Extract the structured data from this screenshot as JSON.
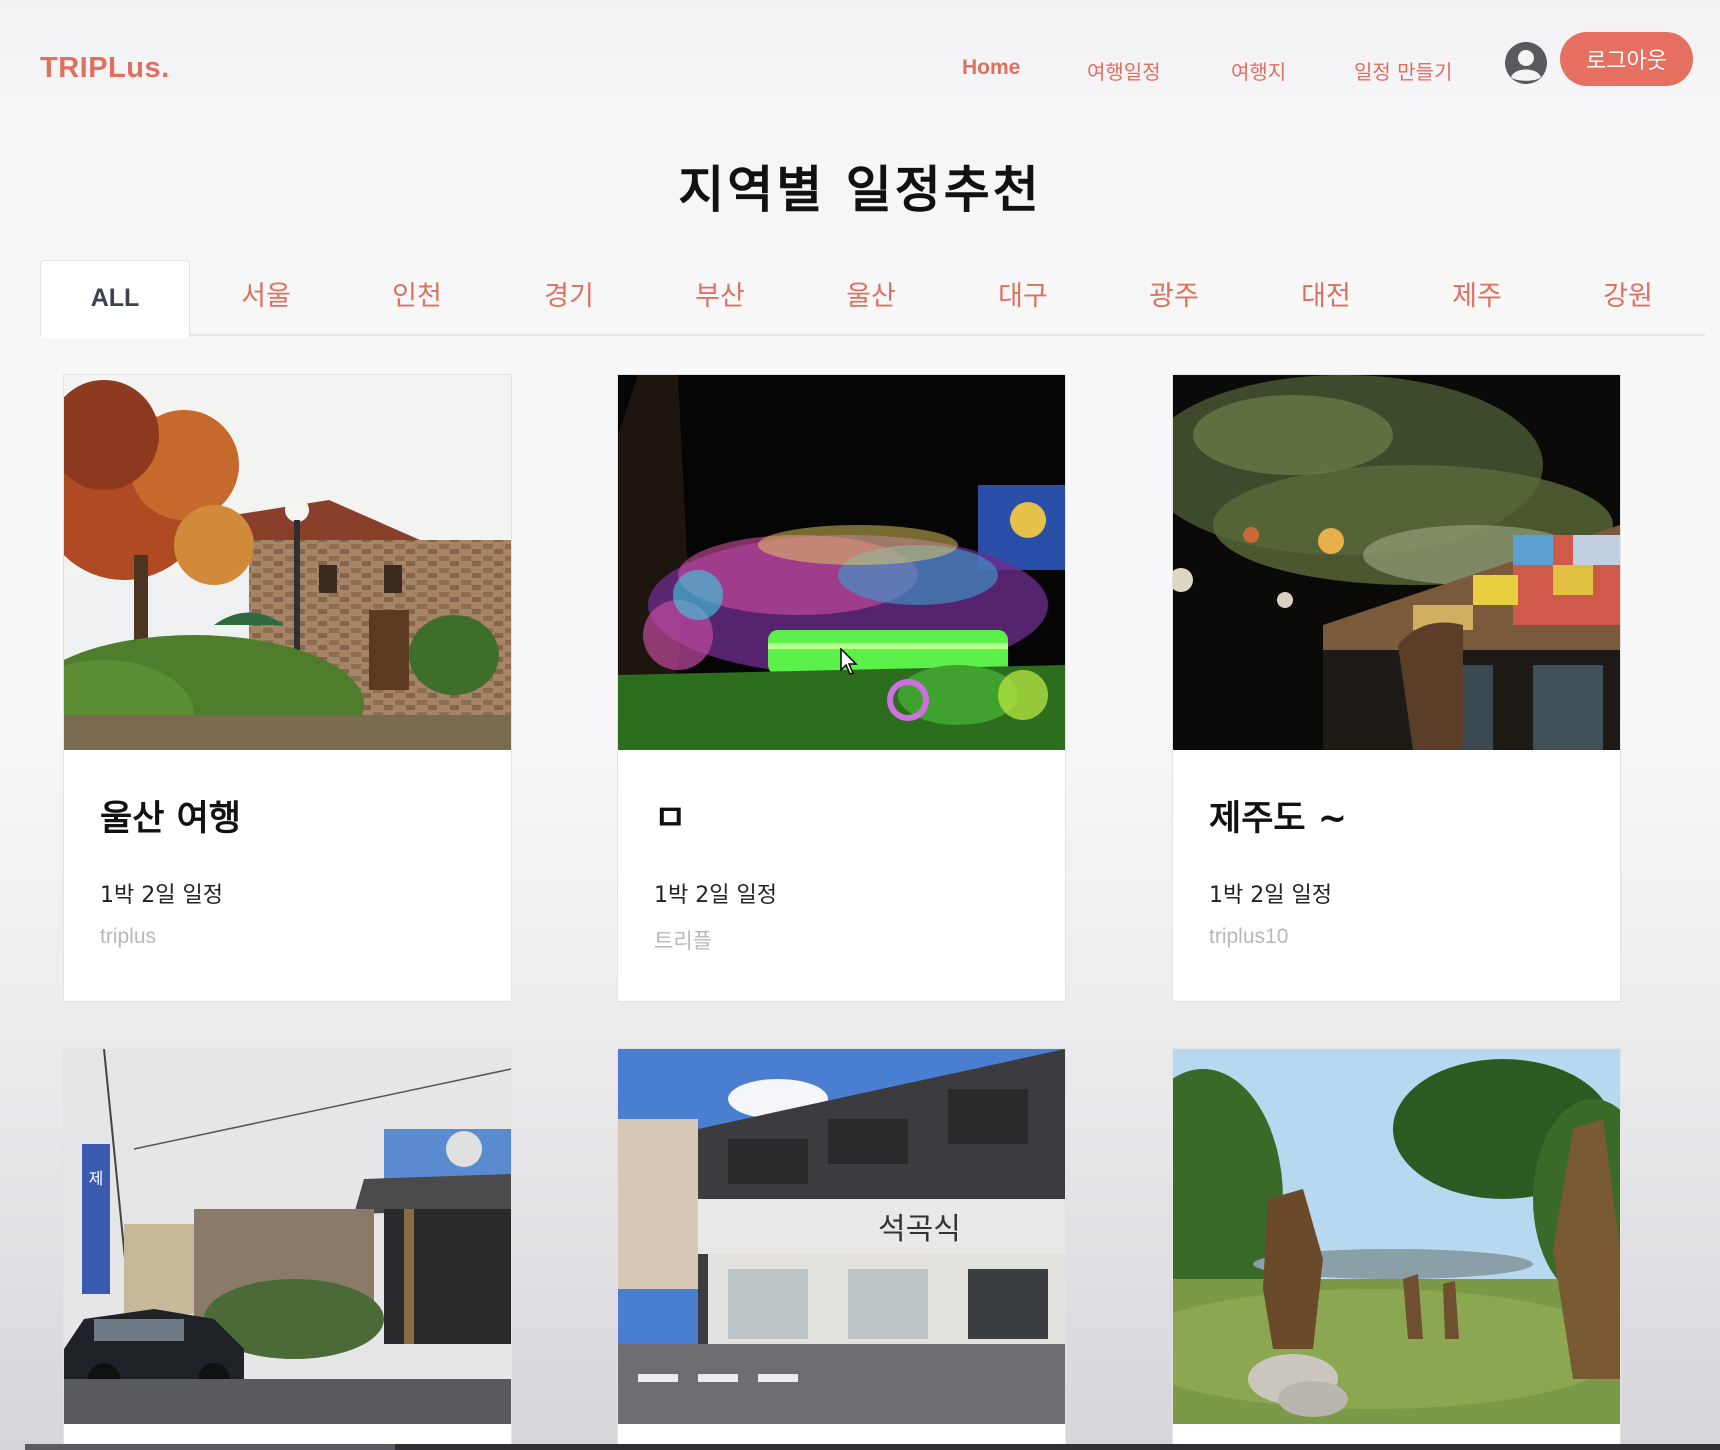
{
  "app": {
    "logo": "TRIPLus."
  },
  "nav": {
    "items": [
      {
        "label": "Home"
      },
      {
        "label": "여행일정"
      },
      {
        "label": "여행지"
      },
      {
        "label": "일정 만들기"
      }
    ],
    "avatar_icon": "user-circle-icon",
    "logout_label": "로그아웃"
  },
  "page": {
    "title": "지역별 일정추천"
  },
  "tabs": [
    {
      "label": "ALL",
      "active": true
    },
    {
      "label": "서울"
    },
    {
      "label": "인천"
    },
    {
      "label": "경기"
    },
    {
      "label": "부산"
    },
    {
      "label": "울산"
    },
    {
      "label": "대구"
    },
    {
      "label": "광주"
    },
    {
      "label": "대전"
    },
    {
      "label": "제주"
    },
    {
      "label": "강원"
    }
  ],
  "cards": [
    {
      "title": "울산 여행",
      "duration": "1박 2일 일정",
      "author": "triplus",
      "image": "stone-house-autumn-photo"
    },
    {
      "title": "ㅁ",
      "duration": "1박 2일 일정",
      "author": "트리플",
      "image": "night-light-garden-photo"
    },
    {
      "title": "제주도 ~",
      "duration": "1박 2일 일정",
      "author": "triplus10",
      "image": "night-tree-lanterns-photo"
    },
    {
      "image": "restaurant-street-photo"
    },
    {
      "image": "two-story-building-photo"
    },
    {
      "image": "warrior-statues-park-photo"
    }
  ],
  "colors": {
    "accent": "#e6705f",
    "text": "#111111",
    "muted": "#b8b8bb"
  }
}
